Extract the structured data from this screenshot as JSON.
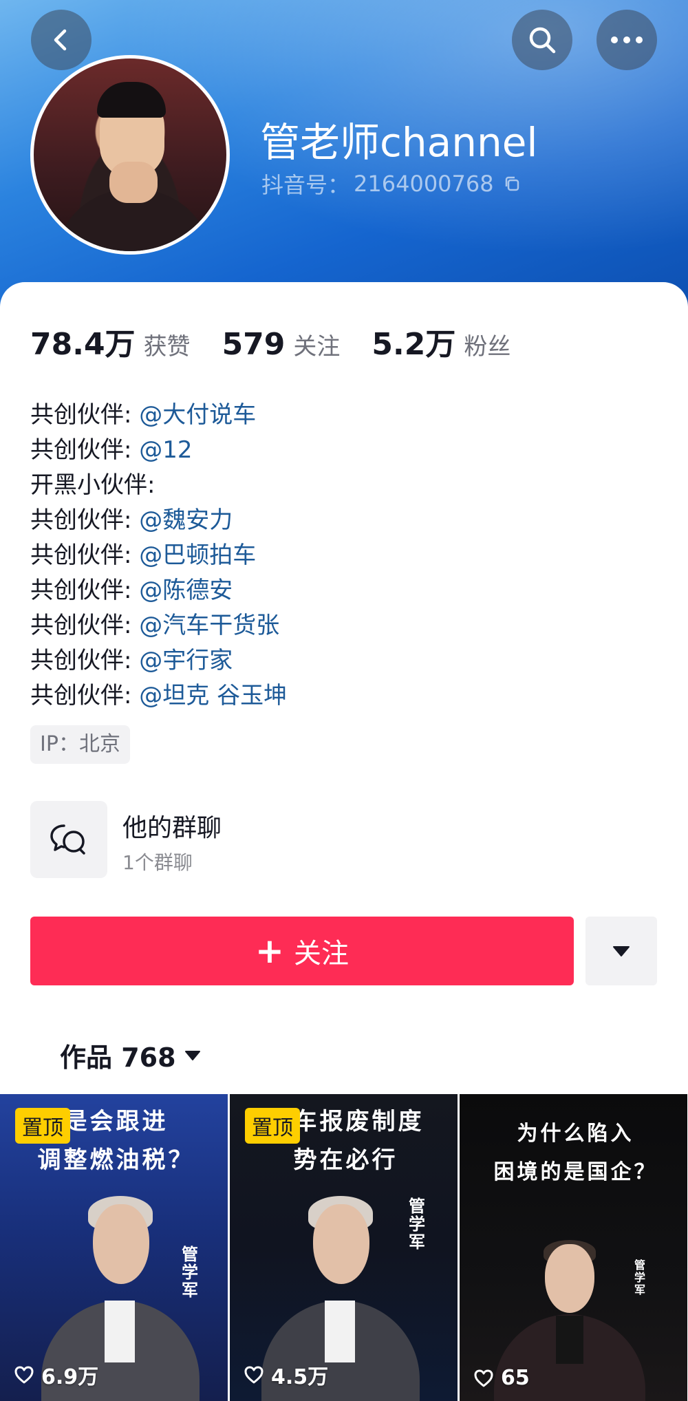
{
  "header": {
    "nickname": "管老师channel",
    "douyin_id_label": "抖音号：",
    "douyin_id": "2164000768"
  },
  "stats": [
    {
      "value": "78.4万",
      "label": "获赞"
    },
    {
      "value": "579",
      "label": "关注"
    },
    {
      "value": "5.2万",
      "label": "粉丝"
    }
  ],
  "bio": [
    {
      "prefix": "共创伙伴: ",
      "mention": "@大付说车"
    },
    {
      "prefix": "共创伙伴: ",
      "mention": "@12"
    },
    {
      "prefix": "开黑小伙伴: ",
      "mention": ""
    },
    {
      "prefix": "共创伙伴: ",
      "mention": "@魏安力"
    },
    {
      "prefix": "共创伙伴: ",
      "mention": "@巴顿拍车"
    },
    {
      "prefix": "共创伙伴: ",
      "mention": "@陈德安"
    },
    {
      "prefix": "共创伙伴: ",
      "mention": "@汽车干货张"
    },
    {
      "prefix": "共创伙伴: ",
      "mention": "@宇行家"
    },
    {
      "prefix": "共创伙伴: ",
      "mention": "@坦克 谷玉坤"
    }
  ],
  "ip_tag": "IP：北京",
  "group_chat": {
    "title": "他的群聊",
    "count": "1个群聊"
  },
  "follow_button": {
    "label": "关注"
  },
  "works_tab": {
    "label": "作品 768"
  },
  "videos": [
    {
      "pinned_label": "置顶",
      "title_line1": "是会跟进",
      "title_line2": "调整燃油税？",
      "name_label": "管学军",
      "likes": "6.9万"
    },
    {
      "pinned_label": "置顶",
      "title_line1": "汽车报废制度",
      "title_line2": "势在必行",
      "name_label": "管学军",
      "likes": "4.5万"
    },
    {
      "pinned_label": "",
      "title_line1": "为什么陷入",
      "title_line2": "困境的是国企？",
      "name_label": "管学军",
      "likes": "65"
    }
  ],
  "colors": {
    "accent": "#fe2c55",
    "mention": "#1d5a98",
    "pin_badge": "#fece00"
  },
  "icons": [
    "back-icon",
    "search-icon",
    "more-icon",
    "copy-icon",
    "group-chat-icon",
    "plus-icon",
    "caret-down-icon",
    "heart-icon"
  ]
}
